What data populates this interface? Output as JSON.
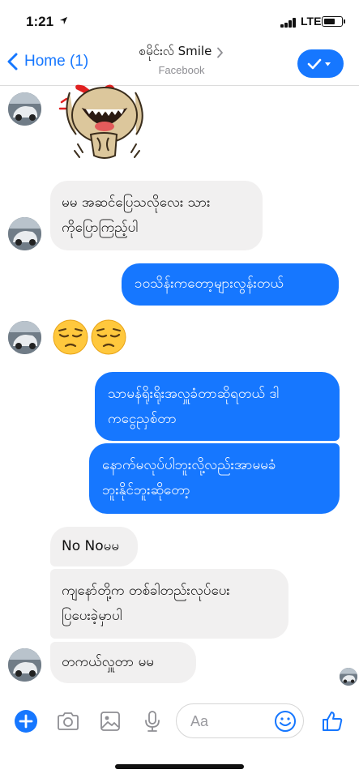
{
  "status_bar": {
    "time": "1:21",
    "network": "LTE",
    "battery_level": 0.65
  },
  "header": {
    "back_label": "Home (1)",
    "contact_name": "စမိုင်းလ် Smile",
    "subtitle": "Facebook"
  },
  "messages": [
    {
      "direction": "incoming",
      "type": "sticker",
      "sticker_icon": "laughing-dog-sticker"
    },
    {
      "direction": "incoming",
      "type": "text",
      "lines": [
        "မမ အဆင်ပြေသလိုလေး သား",
        "ကိုပြောကြည့်ပါ"
      ]
    },
    {
      "direction": "outgoing",
      "type": "text",
      "lines": [
        "၁၀သိန်းကတော့များလွန်းတယ်"
      ]
    },
    {
      "direction": "incoming",
      "type": "emoji",
      "emoji": [
        "😔",
        "😔"
      ]
    },
    {
      "direction": "outgoing",
      "type": "text",
      "lines": [
        "သာမန်ရိုးရိုးအလှူခံတာဆိုရတယ် ဒါ",
        "ကငွေညှစ်တာ"
      ]
    },
    {
      "direction": "outgoing",
      "type": "text",
      "lines": [
        "နောက်မလုပ်ပါဘူးလို့လည်းအာမမခံ",
        "ဘူးနိုင်ဘူးဆိုတော့"
      ]
    },
    {
      "direction": "incoming",
      "type": "text",
      "lines": [
        "No Noမမ"
      ]
    },
    {
      "direction": "incoming",
      "type": "text",
      "lines": [
        "ကျနော်တို့က တစ်ခါတည်းလုပ်ပေး",
        "ပြပေးခဲ့မှာပါ"
      ]
    },
    {
      "direction": "incoming",
      "type": "text",
      "lines": [
        "တကယ်လှူတာ မမ"
      ]
    }
  ],
  "composer": {
    "placeholder": "Aa",
    "icons": [
      "plus-icon",
      "camera-icon",
      "gallery-icon",
      "microphone-icon",
      "emoji-icon",
      "like-icon"
    ]
  },
  "colors": {
    "accent": "#1677ff",
    "incoming_bubble": "#f1f0f0",
    "outgoing_text": "#ffffff"
  }
}
